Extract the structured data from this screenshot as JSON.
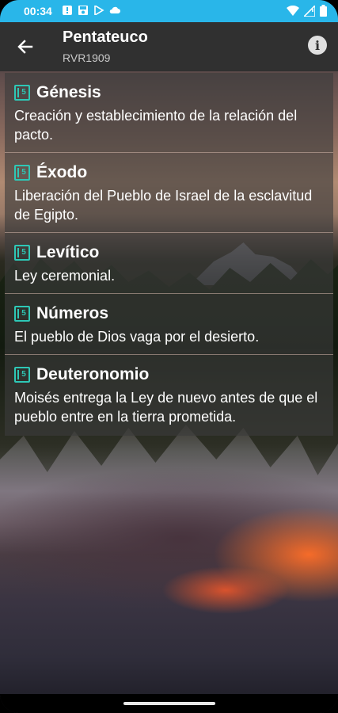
{
  "status_bar": {
    "time": "00:34",
    "icons": [
      "alert-icon",
      "save-icon",
      "play-store-icon",
      "cloud-icon"
    ],
    "right_icons": [
      "wifi-icon",
      "signal-icon",
      "battery-icon"
    ]
  },
  "app_bar": {
    "title": "Pentateuco",
    "subtitle": "RVR1909",
    "back_icon": "arrow-back-icon",
    "info_icon": "info-icon",
    "info_glyph": "i"
  },
  "books": [
    {
      "name": "Génesis",
      "description": "Creación y establecimiento de la relación del pacto.",
      "icon": "book-icon",
      "icon_glyph": "5"
    },
    {
      "name": "Éxodo",
      "description": "Liberación del Pueblo de Israel de la esclavitud de Egipto.",
      "icon": "book-icon",
      "icon_glyph": "5"
    },
    {
      "name": "Levítico",
      "description": "Ley ceremonial.",
      "icon": "book-icon",
      "icon_glyph": "5"
    },
    {
      "name": "Números",
      "description": "El pueblo de Dios vaga por el desierto.",
      "icon": "book-icon",
      "icon_glyph": "5"
    },
    {
      "name": "Deuteronomio",
      "description": "Moisés entrega la Ley de nuevo antes de que el pueblo entre en la tierra prometida.",
      "icon": "book-icon",
      "icon_glyph": "5"
    }
  ],
  "colors": {
    "status_bar": "#29b6e9",
    "app_bar": "#303030",
    "accent": "#2ec8b6"
  }
}
